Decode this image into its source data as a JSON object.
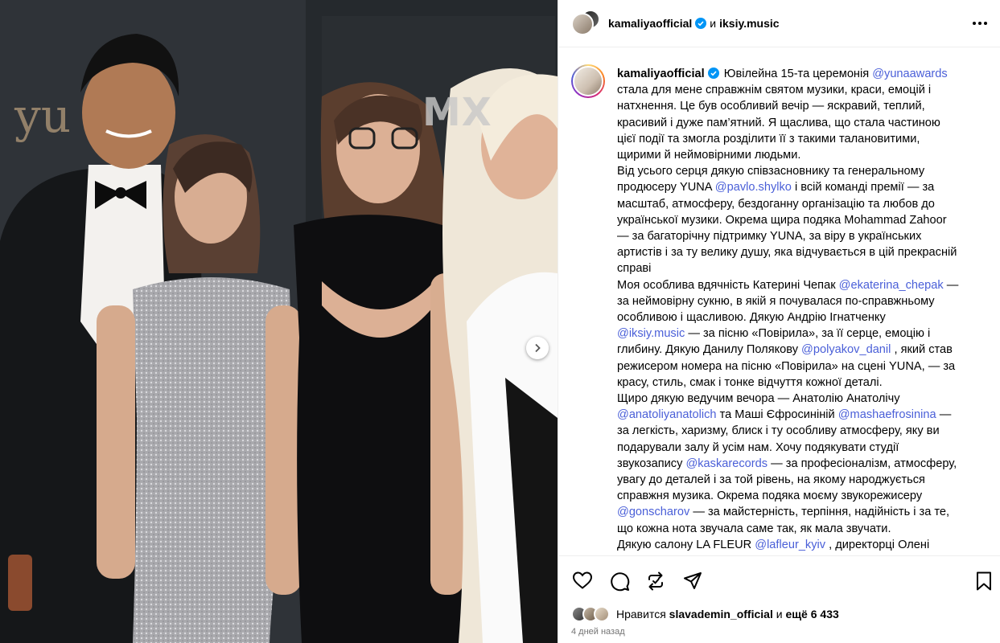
{
  "header": {
    "author": "kamaliyaofficial",
    "and_word": "и",
    "coauthor": "iksiy.music",
    "more_icon": "more-horizontal-icon",
    "verified_icon": "verified-badge-icon"
  },
  "photo": {
    "backdrop_brand": "yu",
    "backdrop_mx": "MX"
  },
  "caption": {
    "author": "kamaliyaofficial",
    "lines": [
      [
        {
          "t": "Ювілейна 15-та церемонія "
        },
        {
          "m": "@yunaawards"
        }
      ],
      [
        {
          "t": "стала для мене справжнім святом музики, краси, емоцій і"
        }
      ],
      [
        {
          "t": "натхнення. Це був особливий вечір — яскравий, теплий,"
        }
      ],
      [
        {
          "t": "красивий і дуже пам’ятний. Я щаслива, що стала частиною"
        }
      ],
      [
        {
          "t": "цієї події та змогла розділити її з такими талановитими,"
        }
      ],
      [
        {
          "t": "щирими й неймовірними людьми."
        }
      ],
      [
        {
          "t": "Від усього серця дякую співзасновнику та генеральному"
        }
      ],
      [
        {
          "t": "продюсеру YUNA "
        },
        {
          "m": "@pavlo.shylko"
        },
        {
          "t": " і всій команді премії — за"
        }
      ],
      [
        {
          "t": "масштаб, атмосферу, бездоганну організацію та любов до"
        }
      ],
      [
        {
          "t": "української музики. Окрема щира подяка Mohammad Zahoor"
        }
      ],
      [
        {
          "t": "— за багаторічну підтримку YUNA, за віру в українських"
        }
      ],
      [
        {
          "t": "артистів і за ту велику душу, яка відчувається в цій прекрасній"
        }
      ],
      [
        {
          "t": "справі"
        }
      ],
      [
        {
          "t": "Моя особлива вдячність Катерині Чепак "
        },
        {
          "m": "@ekaterina_chepak"
        },
        {
          "t": " —"
        }
      ],
      [
        {
          "t": "за неймовірну сукню, в якій я почувалася по-справжньому"
        }
      ],
      [
        {
          "t": "особливою і щасливою. Дякую Андрію Ігнатченку"
        }
      ],
      [
        {
          "m": "@iksiy.music"
        },
        {
          "t": " — за пісню «Повірила», за її серце, емоцію і"
        }
      ],
      [
        {
          "t": "глибину. Дякую Данилу Полякову "
        },
        {
          "m": "@polyakov_danil"
        },
        {
          "t": " , який став"
        }
      ],
      [
        {
          "t": "режисером номера на пісню «Повірила» на сцені YUNA, — за"
        }
      ],
      [
        {
          "t": "красу, стиль, смак і тонке відчуття кожної деталі."
        }
      ],
      [
        {
          "t": "Щиро дякую ведучим вечора — Анатолію Анатолічу"
        }
      ],
      [
        {
          "m": "@anatoliyanatolich"
        },
        {
          "t": " та Маші Єфросиніній "
        },
        {
          "m": "@mashaefrosinina"
        },
        {
          "t": " —"
        }
      ],
      [
        {
          "t": "за легкість, харизму, блиск і ту особливу атмосферу, яку ви"
        }
      ],
      [
        {
          "t": "подарували залу й усім нам. Хочу подякувати студії"
        }
      ],
      [
        {
          "t": "звукозапису "
        },
        {
          "m": "@kaskarecords"
        },
        {
          "t": " — за професіоналізм, атмосферу,"
        }
      ],
      [
        {
          "t": "увагу до деталей і за той рівень, на якому народжується"
        }
      ],
      [
        {
          "t": "справжня музика. Окрема подяка моєму звукорежисеру"
        }
      ],
      [
        {
          "m": "@gonscharov"
        },
        {
          "t": " — за майстерність, терпіння, надійність і за те,"
        }
      ],
      [
        {
          "t": "що кожна нота звучала саме так, як мала звучати."
        }
      ],
      [
        {
          "t": "Дякую салону LA FLEUR "
        },
        {
          "m": "@lafleur_kyiv"
        },
        {
          "t": " , директорці Олені"
        }
      ]
    ]
  },
  "actions": {
    "like_icon": "heart-icon",
    "comment_icon": "comment-icon",
    "repost_icon": "repost-icon",
    "share_icon": "share-icon",
    "save_icon": "bookmark-icon"
  },
  "likes": {
    "prefix": "Нравится",
    "user": "slavademin_official",
    "and_more": "и",
    "count": "ещё 6 433"
  },
  "time": "4 дней назад",
  "colors": {
    "mention": "#4a5fd8",
    "muted": "#737373",
    "verified": "#0095f6"
  }
}
